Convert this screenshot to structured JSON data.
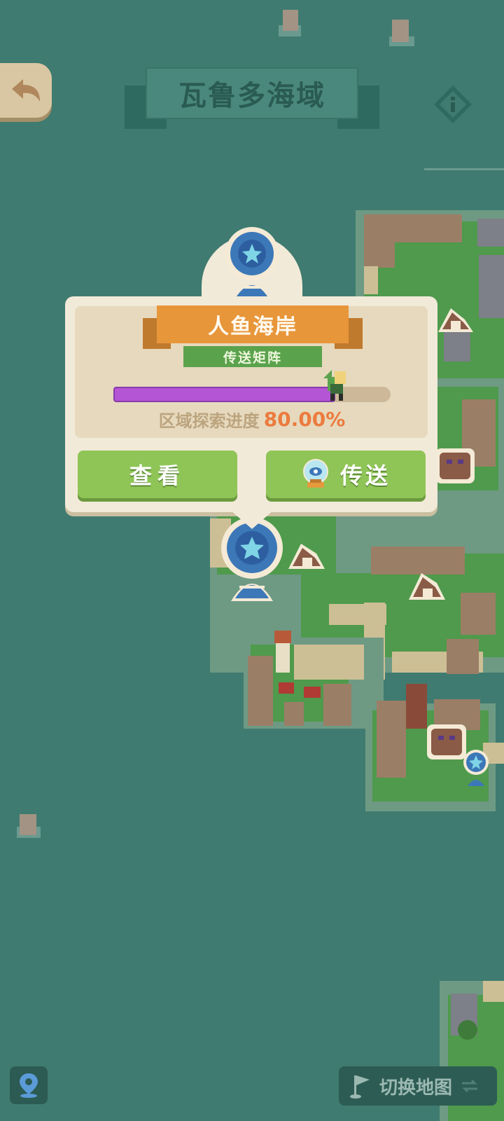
{
  "header": {
    "title": "瓦鲁多海域"
  },
  "popup": {
    "location_name": "人鱼海岸",
    "location_type": "传送矩阵",
    "progress_label": "区域探索进度",
    "progress_value": "80.00%",
    "progress_fraction": 0.8,
    "view_button": "查看",
    "teleport_button": "传送"
  },
  "bottom": {
    "switch_map_label": "切换地图"
  },
  "icons": {
    "back": "back-arrow-icon",
    "info": "info-icon",
    "locate": "location-pin-icon",
    "flag": "flag-icon",
    "swap": "swap-icon",
    "orb": "crystal-ball-icon"
  },
  "colors": {
    "sea": "#3f7b70",
    "progress": "#b455d6",
    "ribbon": "#e8963a",
    "button": "#8fc557",
    "progress_text": "#ec7b3f"
  }
}
